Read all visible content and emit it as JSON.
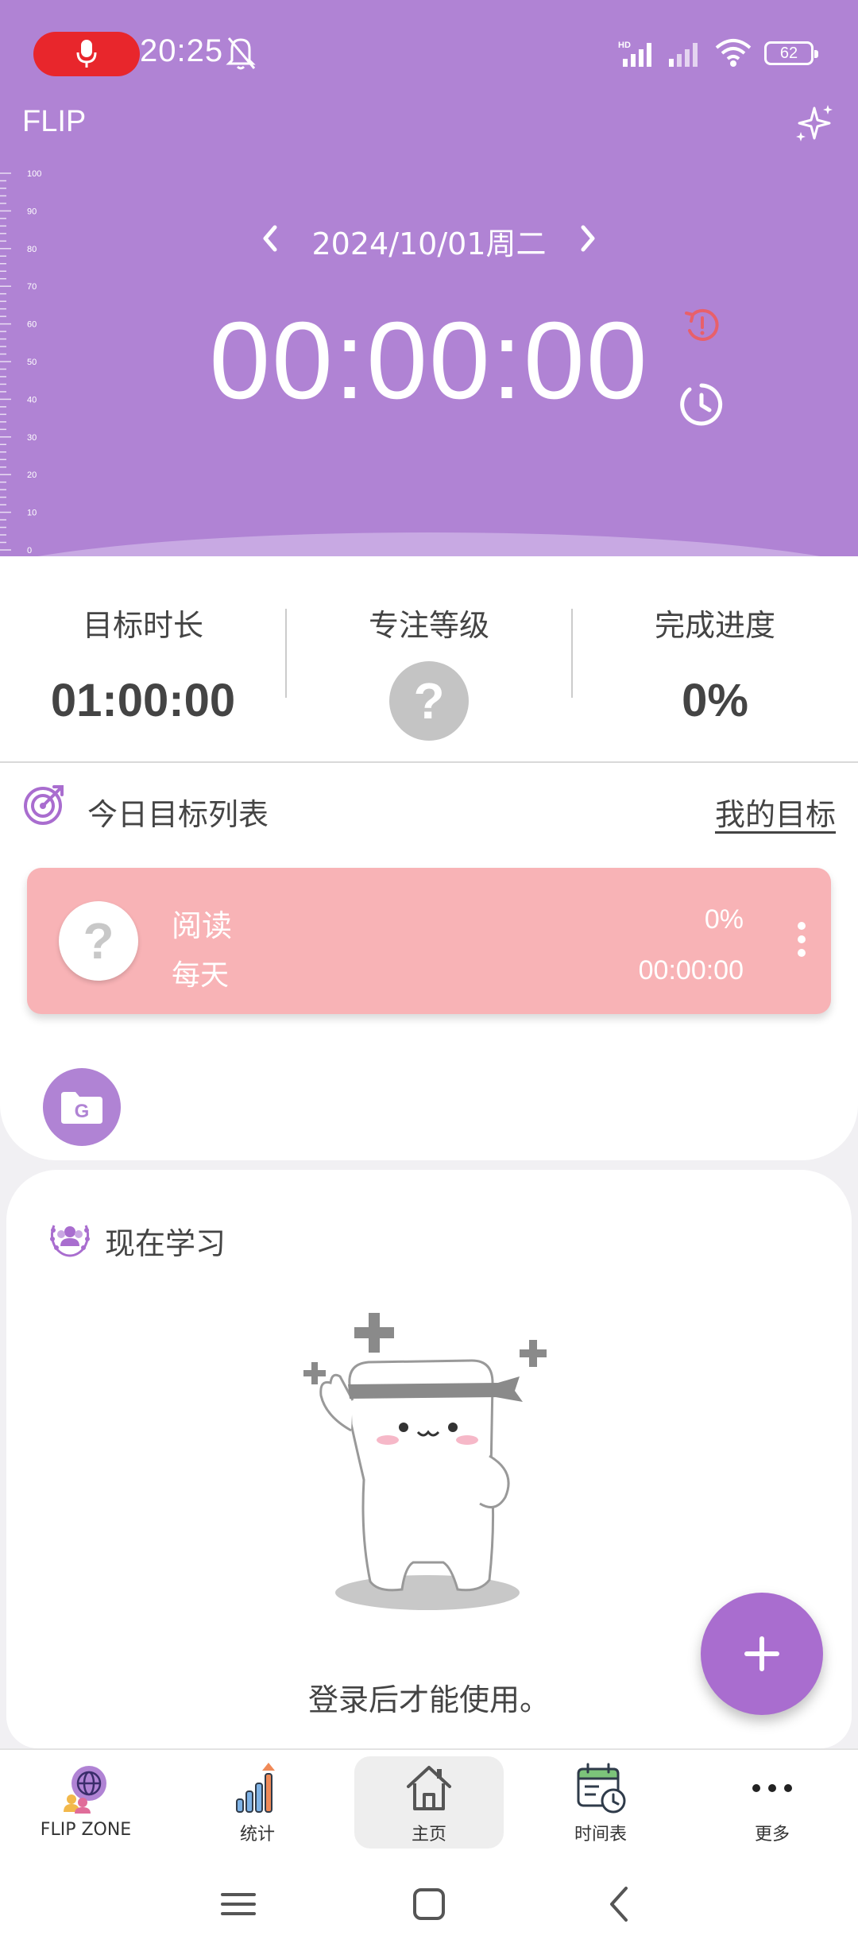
{
  "status_bar": {
    "time": "20:25",
    "network_badge": "HD",
    "battery": "62"
  },
  "header": {
    "app_title": "FLIP",
    "ruler_ticks": [
      "100",
      "90",
      "80",
      "70",
      "60",
      "50",
      "40",
      "30",
      "20",
      "10",
      "0"
    ],
    "date": "2024/10/01周二",
    "timer": "00:00:00"
  },
  "stats": {
    "target_label": "目标时长",
    "target_value": "01:00:00",
    "focus_label": "专注等级",
    "focus_value": "?",
    "progress_label": "完成进度",
    "progress_value": "0%"
  },
  "goals": {
    "title": "今日目标列表",
    "my_goals_link": "我的目标",
    "items": [
      {
        "avatar": "?",
        "name": "阅读",
        "frequency": "每天",
        "percent": "0%",
        "time": "00:00:00",
        "color": "#f8b3b6"
      }
    ],
    "group_button_letter": "G"
  },
  "study": {
    "title": "现在学习",
    "login_note": "登录后才能使用。"
  },
  "bottom_nav": [
    {
      "label": "FLIP ZONE",
      "icon": "globe-people-icon"
    },
    {
      "label": "统计",
      "icon": "bar-chart-icon"
    },
    {
      "label": "主页",
      "icon": "home-icon",
      "active": true
    },
    {
      "label": "时间表",
      "icon": "calendar-clock-icon"
    },
    {
      "label": "更多",
      "icon": "more-dots-icon"
    }
  ],
  "colors": {
    "header_bg": "#b083d4",
    "accent": "#a96dcf",
    "goal_card": "#f8b3b6",
    "record_pill": "#e8262c",
    "reset_icon": "#e8606a"
  }
}
